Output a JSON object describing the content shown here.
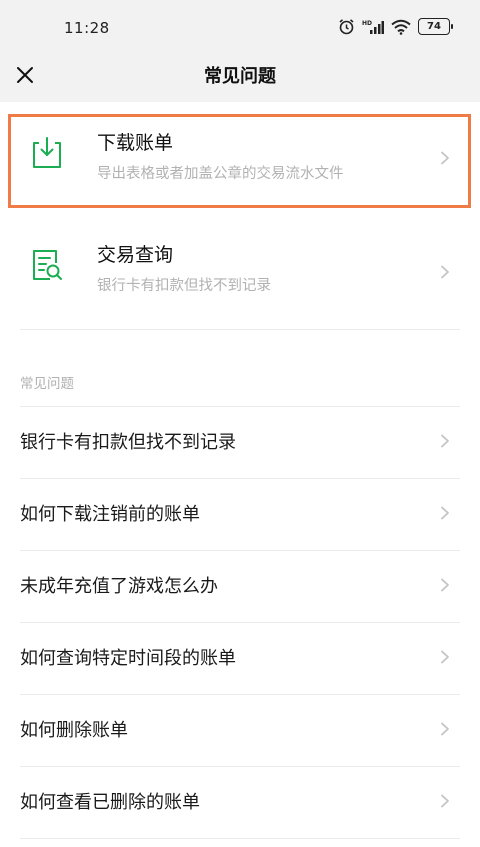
{
  "status": {
    "time": "11:28",
    "battery": "74"
  },
  "nav": {
    "title": "常见问题"
  },
  "features": [
    {
      "title": "下载账单",
      "desc": "导出表格或者加盖公章的交易流水文件",
      "icon": "download-icon"
    },
    {
      "title": "交易查询",
      "desc": "银行卡有扣款但找不到记录",
      "icon": "search-document-icon"
    }
  ],
  "section": {
    "header": "常见问题"
  },
  "faq": [
    "银行卡有扣款但找不到记录",
    "如何下载注销前的账单",
    "未成年充值了游戏怎么办",
    "如何查询特定时间段的账单",
    "如何删除账单",
    "如何查看已删除的账单"
  ],
  "colors": {
    "accent_green": "#1aad52",
    "highlight_orange": "#ef7b46"
  }
}
